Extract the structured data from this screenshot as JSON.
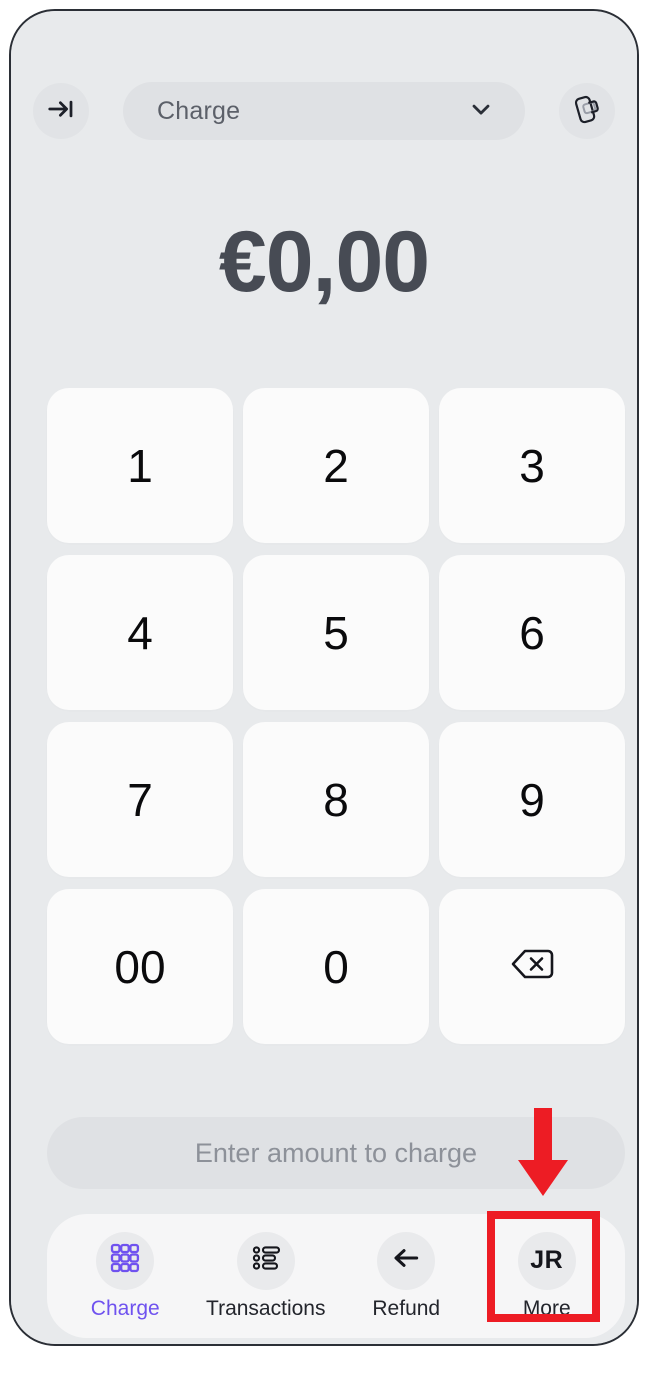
{
  "app": {
    "device": "phone",
    "background_color": "#e8eaec",
    "accent_color": "#6f52ef",
    "annotation_color": "#ed1c24"
  },
  "header": {
    "exit_icon": "exit-arrow-icon",
    "mode_label": "Charge",
    "chevron_icon": "chevron-down-icon",
    "tap_to_pay_icon": "tap-to-pay-card-icon"
  },
  "amount": {
    "currency_symbol": "€",
    "major": "0",
    "decimal_separator": ",",
    "minor": "00",
    "full_text": "€0,00"
  },
  "keypad": {
    "keys": [
      {
        "label": "1",
        "name": "key-1"
      },
      {
        "label": "2",
        "name": "key-2"
      },
      {
        "label": "3",
        "name": "key-3"
      },
      {
        "label": "4",
        "name": "key-4"
      },
      {
        "label": "5",
        "name": "key-5"
      },
      {
        "label": "6",
        "name": "key-6"
      },
      {
        "label": "7",
        "name": "key-7"
      },
      {
        "label": "8",
        "name": "key-8"
      },
      {
        "label": "9",
        "name": "key-9"
      },
      {
        "label": "00",
        "name": "key-double-zero"
      },
      {
        "label": "0",
        "name": "key-0"
      },
      {
        "label": "",
        "name": "key-backspace",
        "icon": "backspace-icon"
      }
    ]
  },
  "cta": {
    "label": "Enter amount to charge",
    "enabled": false
  },
  "bottom_nav": {
    "items": [
      {
        "label": "Charge",
        "icon": "keypad-grid-icon",
        "active": true
      },
      {
        "label": "Transactions",
        "icon": "list-lines-icon",
        "active": false
      },
      {
        "label": "Refund",
        "icon": "arrow-left-icon",
        "active": false
      },
      {
        "label": "More",
        "icon": "avatar-initials",
        "initials": "JR",
        "active": false
      }
    ]
  },
  "annotations": {
    "highlight_target": "More",
    "arrow_direction": "down",
    "box_color": "#ed1c24"
  }
}
